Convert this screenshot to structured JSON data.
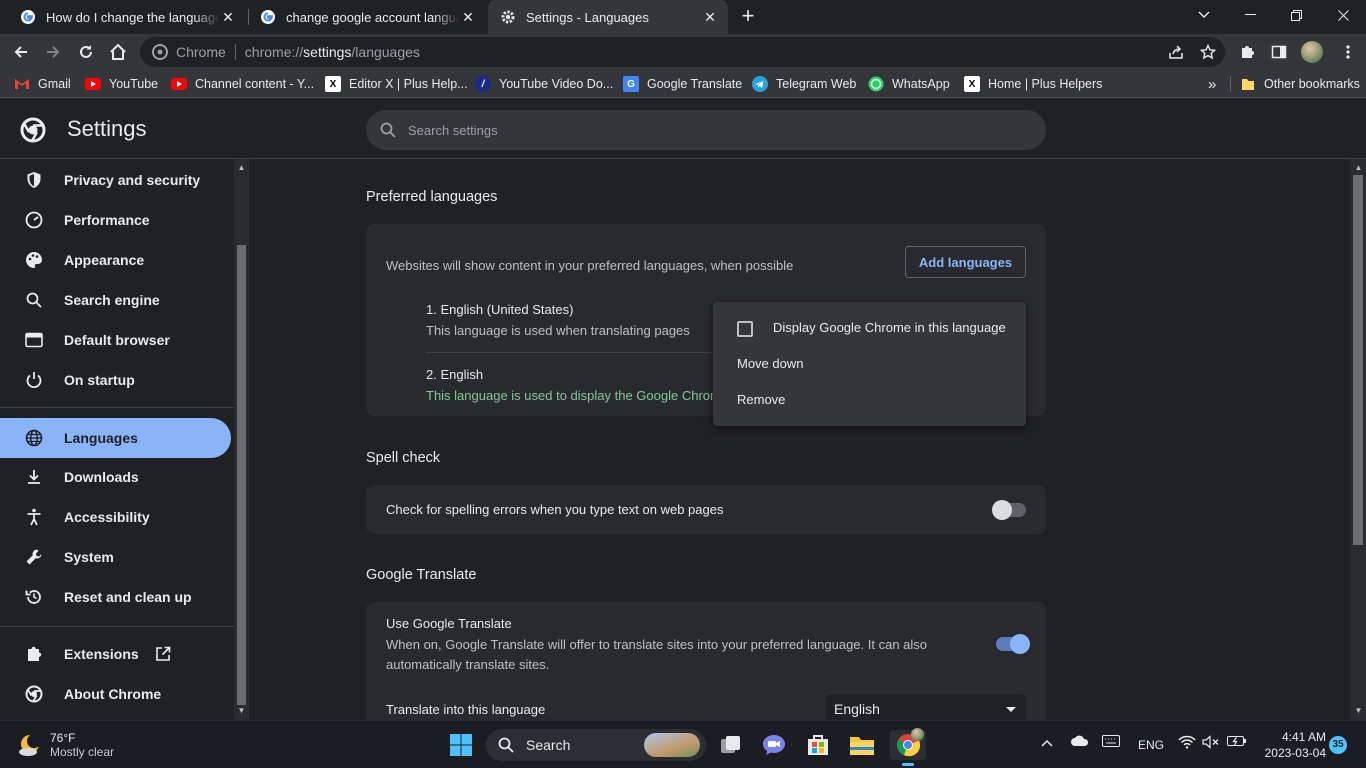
{
  "tabs": [
    {
      "title": "How do I change the language sp",
      "active": false
    },
    {
      "title": "change google account language",
      "active": false
    },
    {
      "title": "Settings - Languages",
      "active": true
    }
  ],
  "omnibox": {
    "chip": "Chrome",
    "url_scheme": "chrome://",
    "url_host": "settings",
    "url_path": "/languages"
  },
  "bookmarks": [
    {
      "label": "Gmail",
      "icon": "gmail-icon"
    },
    {
      "label": "YouTube",
      "icon": "youtube-icon"
    },
    {
      "label": "Channel content - Y...",
      "icon": "youtube-icon"
    },
    {
      "label": "Editor X | Plus Help...",
      "icon": "x-icon"
    },
    {
      "label": "YouTube Video Do...",
      "icon": "download-icon"
    },
    {
      "label": "Google Translate",
      "icon": "translate-icon"
    },
    {
      "label": "Telegram Web",
      "icon": "telegram-icon"
    },
    {
      "label": "WhatsApp",
      "icon": "whatsapp-icon"
    },
    {
      "label": "Home | Plus Helpers",
      "icon": "x-icon"
    }
  ],
  "bookmarks_more": "»",
  "other_bookmarks": "Other bookmarks",
  "settings": {
    "title": "Settings",
    "search_placeholder": "Search settings"
  },
  "sidebar": {
    "items": [
      {
        "label": "Privacy and security",
        "icon": "shield-icon"
      },
      {
        "label": "Performance",
        "icon": "gauge-icon"
      },
      {
        "label": "Appearance",
        "icon": "palette-icon"
      },
      {
        "label": "Search engine",
        "icon": "search-icon"
      },
      {
        "label": "Default browser",
        "icon": "browser-icon"
      },
      {
        "label": "On startup",
        "icon": "power-icon"
      },
      {
        "label": "Languages",
        "icon": "globe-icon",
        "selected": true
      },
      {
        "label": "Downloads",
        "icon": "download-icon"
      },
      {
        "label": "Accessibility",
        "icon": "accessibility-icon"
      },
      {
        "label": "System",
        "icon": "wrench-icon"
      },
      {
        "label": "Reset and clean up",
        "icon": "restore-icon"
      },
      {
        "label": "Extensions",
        "icon": "puzzle-icon"
      },
      {
        "label": "About Chrome",
        "icon": "chrome-icon"
      }
    ]
  },
  "preferred": {
    "title": "Preferred languages",
    "description": "Websites will show content in your preferred languages, when possible",
    "add_button": "Add languages",
    "languages": [
      {
        "name": "1. English (United States)",
        "note": "This language is used when translating pages"
      },
      {
        "name": "2. English",
        "note": "This language is used to display the Google Chrome UI"
      }
    ]
  },
  "context_menu": {
    "display_in_language": "Display Google Chrome in this language",
    "move_down": "Move down",
    "remove": "Remove"
  },
  "spellcheck": {
    "title": "Spell check",
    "label": "Check for spelling errors when you type text on web pages",
    "enabled": false
  },
  "translate": {
    "title": "Google Translate",
    "use_label": "Use Google Translate",
    "use_desc": "When on, Google Translate will offer to translate sites into your preferred language. It can also automatically translate sites.",
    "enabled": true,
    "into_label": "Translate into this language",
    "into_value": "English"
  },
  "taskbar": {
    "weather_temp": "76°F",
    "weather_desc": "Mostly clear",
    "search": "Search",
    "lang": "ENG",
    "time": "4:41 AM",
    "date": "2023-03-04",
    "notifications": "35"
  },
  "colors": {
    "accent": "#8ab4f8",
    "background": "#202124",
    "card": "#292a2d",
    "green_note": "#81c995"
  }
}
